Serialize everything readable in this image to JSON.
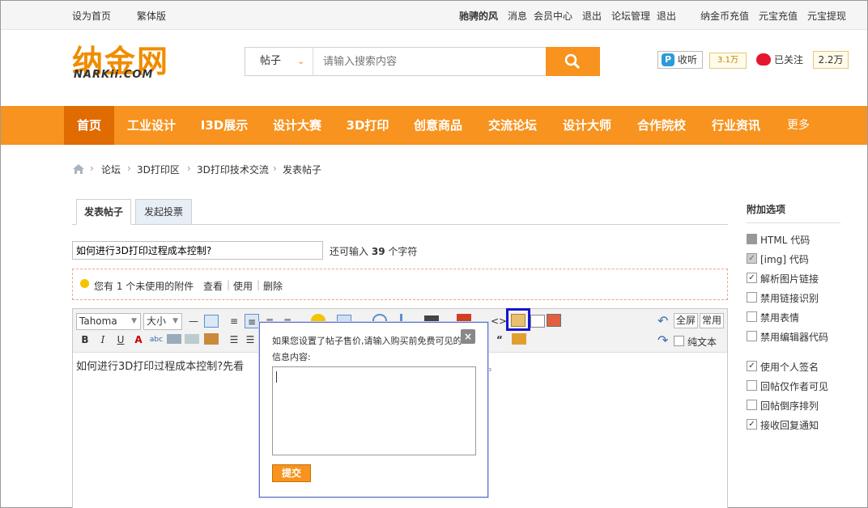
{
  "topbar": {
    "set_home": "设为首页",
    "traditional": "繁体版",
    "username": "驰骋的风",
    "messages": "消息",
    "member_center": "会员中心",
    "logout1": "退出",
    "forum_admin": "论坛管理",
    "logout2": "退出",
    "coin_recharge": "纳金币充值",
    "yuanbao_recharge": "元宝充值",
    "yuanbao_withdraw": "元宝提现"
  },
  "header": {
    "logo_text": "纳金网",
    "logo_sub": "NARKii.COM",
    "search_type": "帖子",
    "search_placeholder": "请输入搜索内容",
    "listen_label": "收听",
    "listen_count": "3.1万",
    "follow_label": "已关注",
    "follow_count": "2.2万"
  },
  "nav": {
    "items": [
      "首页",
      "工业设计",
      "I3D展示",
      "设计大赛",
      "3D打印",
      "创意商品",
      "交流论坛",
      "设计大师",
      "合作院校",
      "行业资讯"
    ],
    "more": "更多"
  },
  "breadcrumb": {
    "items": [
      "论坛",
      "3D打印区",
      "3D打印技术交流",
      "发表帖子"
    ]
  },
  "tabs": {
    "post": "发表帖子",
    "vote": "发起投票"
  },
  "title_field": {
    "value": "如何进行3D打印过程成本控制?",
    "hint_prefix": "还可输入",
    "hint_count": "39",
    "hint_suffix": "个字符"
  },
  "attachment": {
    "notice": "您有 1 个未使用的附件",
    "view": "查看",
    "use": "使用",
    "delete": "删除"
  },
  "editor": {
    "font": "Tahoma",
    "size": "大小",
    "fullscreen": "全屏",
    "common": "常用",
    "plain_text": "纯文本",
    "content": "如何进行3D打印过程成本控制?先看"
  },
  "popup": {
    "message": "如果您设置了帖子售价,请输入购买前免费可见的信息内容:",
    "close": "×",
    "submit": "提交"
  },
  "sidebar": {
    "title": "附加选项",
    "options": [
      {
        "label": "HTML 代码",
        "state": "disabled"
      },
      {
        "label": "[img] 代码",
        "state": "checked-disabled"
      },
      {
        "label": "解析图片链接",
        "state": "checked"
      },
      {
        "label": "禁用链接识别",
        "state": "unchecked"
      },
      {
        "label": "禁用表情",
        "state": "unchecked"
      },
      {
        "label": "禁用编辑器代码",
        "state": "unchecked"
      },
      {
        "label": "使用个人签名",
        "state": "checked"
      },
      {
        "label": "回帖仅作者可见",
        "state": "unchecked"
      },
      {
        "label": "回帖倒序排列",
        "state": "unchecked"
      },
      {
        "label": "接收回复通知",
        "state": "checked"
      }
    ]
  },
  "colors": {
    "brand_orange": "#f7931e",
    "nav_active": "#e06b00",
    "highlight_blue": "#1515d0"
  }
}
